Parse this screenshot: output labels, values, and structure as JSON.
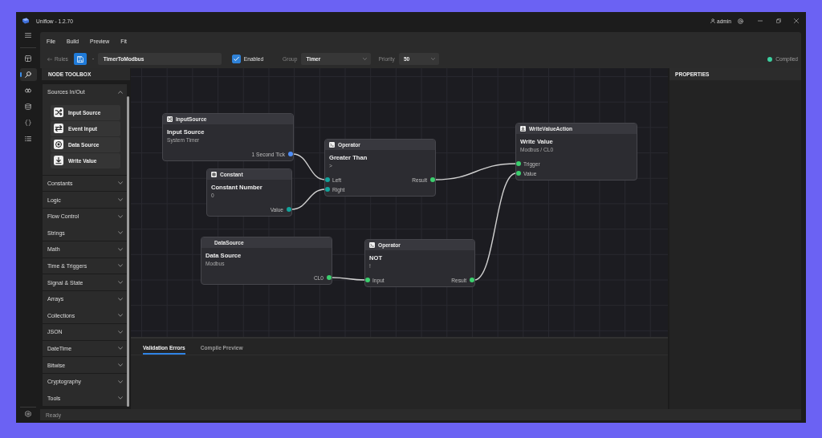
{
  "window": {
    "title": "Uniflow - 1.2.70",
    "user": "admin"
  },
  "nav_rail": {
    "items": [
      {
        "kind": "window",
        "selected": false
      },
      {
        "kind": "magnifier",
        "selected": true
      },
      {
        "kind": "link",
        "selected": false
      },
      {
        "kind": "database",
        "selected": false
      },
      {
        "kind": "braces",
        "selected": false
      },
      {
        "kind": "list",
        "selected": false
      }
    ]
  },
  "menu": [
    "File",
    "Build",
    "Preview",
    "Fit"
  ],
  "toolbar": {
    "back_link": "Rules",
    "rule_name": "TimerToModbus",
    "enabled": {
      "label": "Enabled",
      "checked": true
    },
    "group": {
      "label": "Group",
      "value": "Timer"
    },
    "priority": {
      "label": "Priority",
      "value": "50"
    },
    "build_status": {
      "label": "Compiled",
      "ok": true
    }
  },
  "toolbox": {
    "title": "NODE TOOLBOX",
    "sections": [
      {
        "label": "Sources In/Out",
        "expanded": true,
        "items": [
          {
            "kind": "input_source",
            "label": "Input Source"
          },
          {
            "kind": "event_input",
            "label": "Event Input"
          },
          {
            "kind": "data_source",
            "label": "Data Source"
          },
          {
            "kind": "write_value",
            "label": "Write Value"
          }
        ]
      },
      {
        "label": "Constants",
        "expanded": false
      },
      {
        "label": "Logic",
        "expanded": false
      },
      {
        "label": "Flow Control",
        "expanded": false
      },
      {
        "label": "Strings",
        "expanded": false
      },
      {
        "label": "Math",
        "expanded": false
      },
      {
        "label": "Time & Triggers",
        "expanded": false
      },
      {
        "label": "Signal & State",
        "expanded": false
      },
      {
        "label": "Arrays",
        "expanded": false
      },
      {
        "label": "Collections",
        "expanded": false
      },
      {
        "label": "JSON",
        "expanded": false
      },
      {
        "label": "DateTime",
        "expanded": false
      },
      {
        "label": "Bitwise",
        "expanded": false
      },
      {
        "label": "Cryptography",
        "expanded": false
      },
      {
        "label": "Tools",
        "expanded": false
      }
    ]
  },
  "canvas": {
    "nodes": [
      {
        "kind": "input_source",
        "type": "InputSource",
        "title": "Input Source",
        "subtitle": "System Timer",
        "outputs": [
          {
            "label": "1 Second Tick",
            "color": "#4f8ef7"
          }
        ]
      },
      {
        "kind": "constant",
        "type": "Constant",
        "title": "Constant Number",
        "subtitle": "0",
        "outputs": [
          {
            "label": "Value",
            "color": "#12a39b"
          }
        ]
      },
      {
        "kind": "operator",
        "type": "Operator",
        "title": "Greater Than",
        "subtitle": ">",
        "inputs": [
          {
            "label": "Left",
            "color": "#12a39b"
          },
          {
            "label": "Right",
            "color": "#12a39b"
          }
        ],
        "outputs": [
          {
            "label": "Result",
            "color": "#3ccf6e"
          }
        ]
      },
      {
        "kind": "write_value",
        "type": "WriteValueAction",
        "title": "Write Value",
        "subtitle": "Modbus / CL0",
        "inputs": [
          {
            "label": "Trigger",
            "color": "#3ccf6e"
          },
          {
            "label": "Value",
            "color": "#3ccf6e"
          }
        ]
      },
      {
        "kind": "data_source",
        "type": "DataSource",
        "title": "Data Source",
        "subtitle": "Modbus",
        "outputs": [
          {
            "label": "CL0",
            "color": "#3ccf6e"
          }
        ]
      },
      {
        "kind": "operator",
        "type": "Operator",
        "title": "NOT",
        "subtitle": "!",
        "inputs": [
          {
            "label": "Input",
            "color": "#3ccf6e"
          }
        ],
        "outputs": [
          {
            "label": "Result",
            "color": "#3ccf6e"
          }
        ]
      }
    ]
  },
  "bottom_panel": {
    "tabs": [
      {
        "label": "Validation Errors",
        "selected": true
      },
      {
        "label": "Compile Preview",
        "selected": false
      }
    ]
  },
  "properties": {
    "title": "PROPERTIES"
  },
  "status_bar": {
    "text": "Ready"
  }
}
